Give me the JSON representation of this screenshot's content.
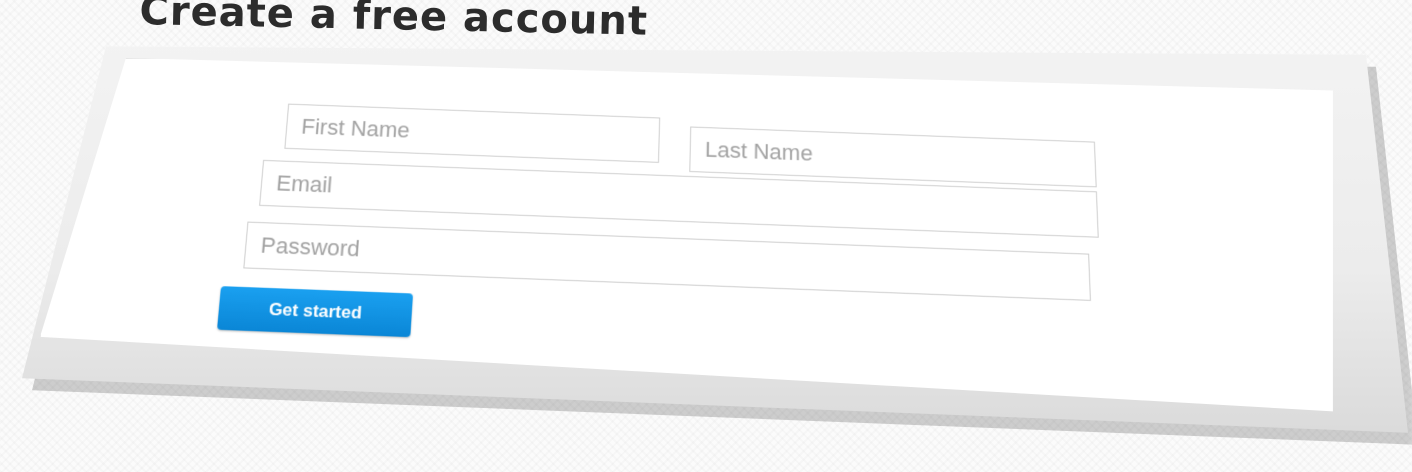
{
  "heading": "Create a free account",
  "form": {
    "first_name": {
      "placeholder": "First Name",
      "value": ""
    },
    "last_name": {
      "placeholder": "Last Name",
      "value": ""
    },
    "email": {
      "placeholder": "Email",
      "value": ""
    },
    "password": {
      "placeholder": "Password",
      "value": ""
    },
    "submit_label": "Get started"
  },
  "colors": {
    "button": "#0a86d6",
    "field_border": "#cfcfcf",
    "placeholder": "#a3a3a3",
    "heading": "#2c2c2c"
  }
}
